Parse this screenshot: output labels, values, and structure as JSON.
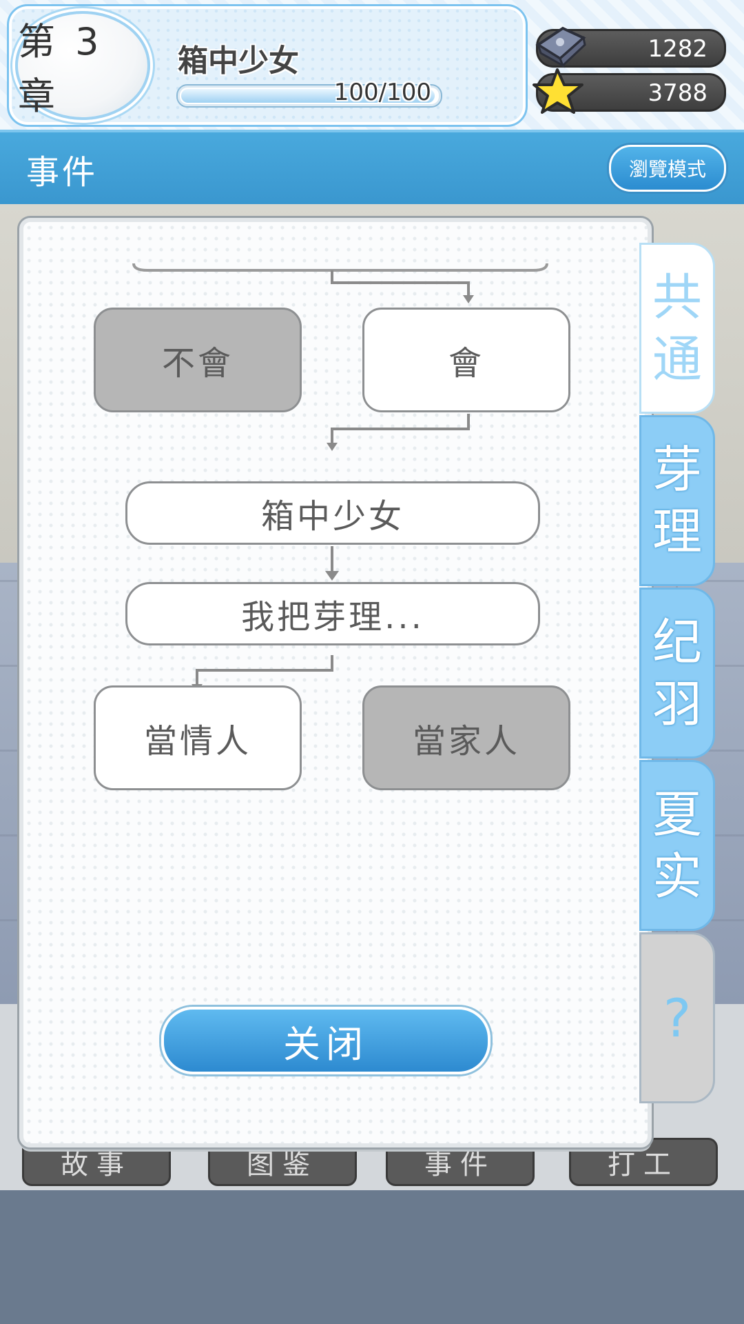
{
  "header": {
    "chapter_label": "第 3 章",
    "chapter_title": "箱中少女",
    "progress_text": "100/100",
    "progress_fraction": 1.0,
    "currencies": [
      {
        "name": "ticket",
        "icon": "ticket-icon",
        "value": "1282"
      },
      {
        "name": "star",
        "icon": "star-icon",
        "value": "3788"
      }
    ]
  },
  "section": {
    "title": "事件",
    "browse_button": "瀏覽模式"
  },
  "flowchart": {
    "choices_top": [
      {
        "label": "不會",
        "state": "unselected"
      },
      {
        "label": "會",
        "state": "selected"
      }
    ],
    "events": [
      {
        "label": "箱中少女"
      },
      {
        "label": "我把芽理..."
      }
    ],
    "choices_bottom": [
      {
        "label": "當情人",
        "state": "selected"
      },
      {
        "label": "當家人",
        "state": "unselected"
      }
    ]
  },
  "dialog": {
    "close_button": "关闭"
  },
  "side_tabs": [
    {
      "label": "共\n通",
      "active": true
    },
    {
      "label": "芽\n理",
      "active": false
    },
    {
      "label": "纪\n羽",
      "active": false
    },
    {
      "label": "夏\n实",
      "active": false
    },
    {
      "label": "?",
      "active": false
    }
  ],
  "bottom_nav": [
    "故事",
    "图鉴",
    "事件",
    "打工"
  ],
  "colors": {
    "accent_blue": "#3a97cf",
    "button_blue": "#2d8ad0",
    "unselected_gray": "#b6b6b6",
    "star_yellow": "#ffe033"
  }
}
